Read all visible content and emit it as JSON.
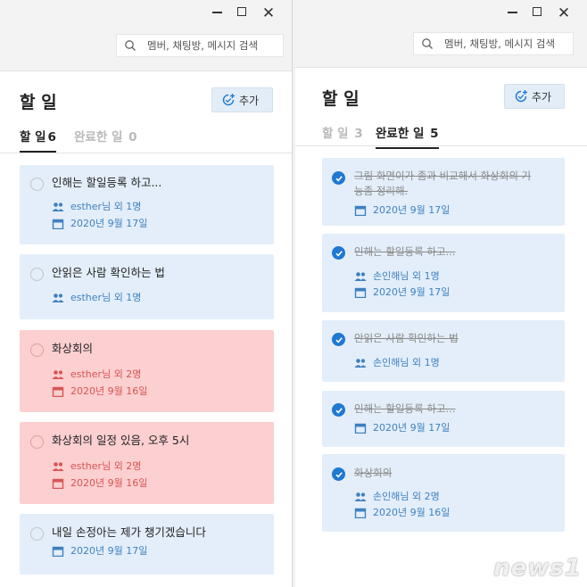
{
  "left_panel": {
    "search_placeholder": "멤버, 채팅방, 메시지 검색",
    "title": "할 일",
    "add_label": "추가",
    "tabs": [
      {
        "label": "할 일",
        "count": "6",
        "active": true
      },
      {
        "label": "완료한 일",
        "count": "0",
        "active": false
      }
    ],
    "tasks": [
      {
        "title": "인해는 할일등록 하고...",
        "assignee": "esther님 외 1명",
        "date": "2020년 9월 17일",
        "style": "blue"
      },
      {
        "title": "안읽은 사람 확인하는 법",
        "assignee": "esther님 외 1명",
        "date": "",
        "style": "blue"
      },
      {
        "title": "화상회의",
        "assignee": "esther님 외 2명",
        "date": "2020년 9월 16일",
        "style": "red"
      },
      {
        "title": "화상회의 일정 있음, 오후 5시",
        "assignee": "esther님 외 2명",
        "date": "2020년 9월 16일",
        "style": "red"
      },
      {
        "title": "내일 손정아는 제가 챙기겠습니다",
        "assignee": "",
        "date": "2020년 9월 17일",
        "style": "blue"
      }
    ]
  },
  "right_panel": {
    "search_placeholder": "멤버, 채팅방, 메시지 검색",
    "title": "할 일",
    "add_label": "추가",
    "tabs": [
      {
        "label": "할 일",
        "count": "3",
        "active": false
      },
      {
        "label": "완료한 일",
        "count": "5",
        "active": true
      }
    ],
    "tasks": [
      {
        "title_line1": "그림 화면이가 좀과 비교해서 화상회의 기",
        "title_line2": "능좀 정리해.",
        "assignee": "",
        "date": "2020년 9월 17일"
      },
      {
        "title_line1": "인해는 할일등록 하고...",
        "title_line2": "",
        "assignee": "손인해님 외 1명",
        "date": "2020년 9월 17일"
      },
      {
        "title_line1": "안읽은 사람 확인하는 법",
        "title_line2": "",
        "assignee": "손인해님 외 1명",
        "date": ""
      },
      {
        "title_line1": "인해는 할일등록 하고...",
        "title_line2": "",
        "assignee": "",
        "date": "2020년 9월 17일"
      },
      {
        "title_line1": "화상회의",
        "title_line2": "",
        "assignee": "손인해님 외 2명",
        "date": "2020년 9월 16일"
      }
    ]
  },
  "watermark": "news1",
  "colors": {
    "accent": "#1f78d1",
    "card_blue": "#e3eefa",
    "card_red": "#fccfd0",
    "meta_blue": "#3e80bf",
    "meta_red": "#d95454"
  }
}
